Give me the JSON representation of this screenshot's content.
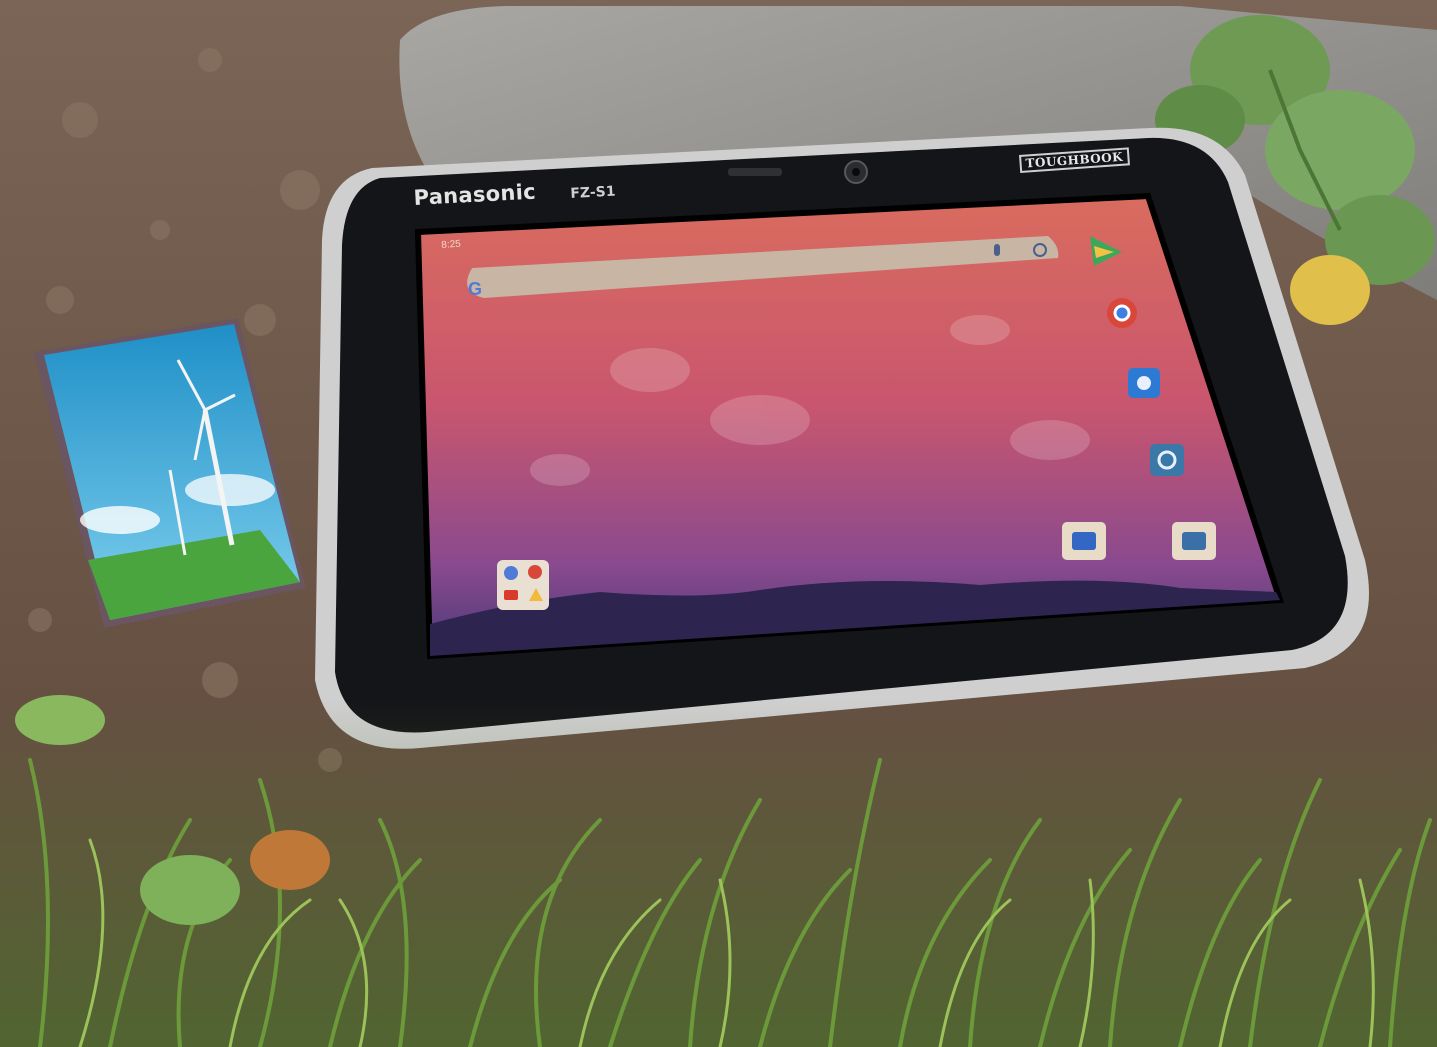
{
  "photo": {
    "brand_logo": "Panasonic",
    "model_label": "FZ-S1",
    "badge": "TOUGHBOOK",
    "status_time": "8:25"
  },
  "colors": {
    "soil": "#6f5a49",
    "rock": "#9a9894",
    "bezel": "#141518",
    "frame": "#c9c9c9",
    "wallpaper_top": "#c96a6e",
    "wallpaper_bottom": "#7a4a8e",
    "grass": "#5f8a3a"
  }
}
